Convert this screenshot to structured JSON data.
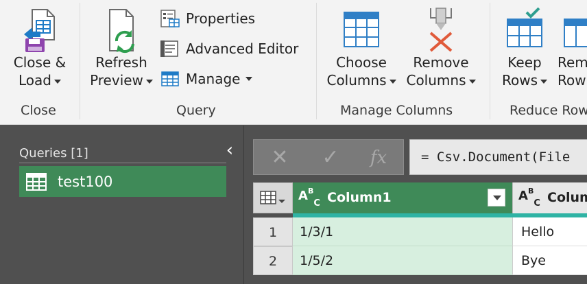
{
  "ribbon": {
    "groups": {
      "close": {
        "label": "Close",
        "close_load": {
          "line1": "Close &",
          "line2": "Load"
        }
      },
      "query": {
        "label": "Query",
        "refresh_preview": {
          "line1": "Refresh",
          "line2": "Preview"
        },
        "properties": "Properties",
        "advanced_editor": "Advanced Editor",
        "manage": "Manage"
      },
      "manage_columns": {
        "label": "Manage Columns",
        "choose_columns": {
          "line1": "Choose",
          "line2": "Columns"
        },
        "remove_columns": {
          "line1": "Remove",
          "line2": "Columns"
        }
      },
      "reduce_rows": {
        "label": "Reduce Row",
        "keep_rows": {
          "line1": "Keep",
          "line2": "Rows"
        },
        "remove_rows": {
          "line1": "Rem",
          "line2": "Row"
        }
      }
    }
  },
  "queries_pane": {
    "title": "Queries [1]",
    "collapse_glyph": "‹",
    "items": [
      {
        "label": "test100"
      }
    ]
  },
  "formula_bar": {
    "cancel_glyph": "✕",
    "commit_glyph": "✓",
    "fx_glyph": "fx",
    "formula": "= Csv.Document(File"
  },
  "grid": {
    "columns": [
      {
        "type_top": "A",
        "type_sup": "B",
        "type_sub": "C",
        "name": "Column1"
      },
      {
        "type_top": "A",
        "type_sup": "B",
        "type_sub": "C",
        "name": "Colum"
      }
    ],
    "rows": [
      {
        "num": "1",
        "col1": "1/3/1",
        "col2": "Hello"
      },
      {
        "num": "2",
        "col1": "1/5/2",
        "col2": "Bye"
      }
    ]
  },
  "colors": {
    "accent_green": "#3f8a58",
    "quality_teal": "#2fb3a4",
    "cell_highlight": "#d7efdf"
  }
}
